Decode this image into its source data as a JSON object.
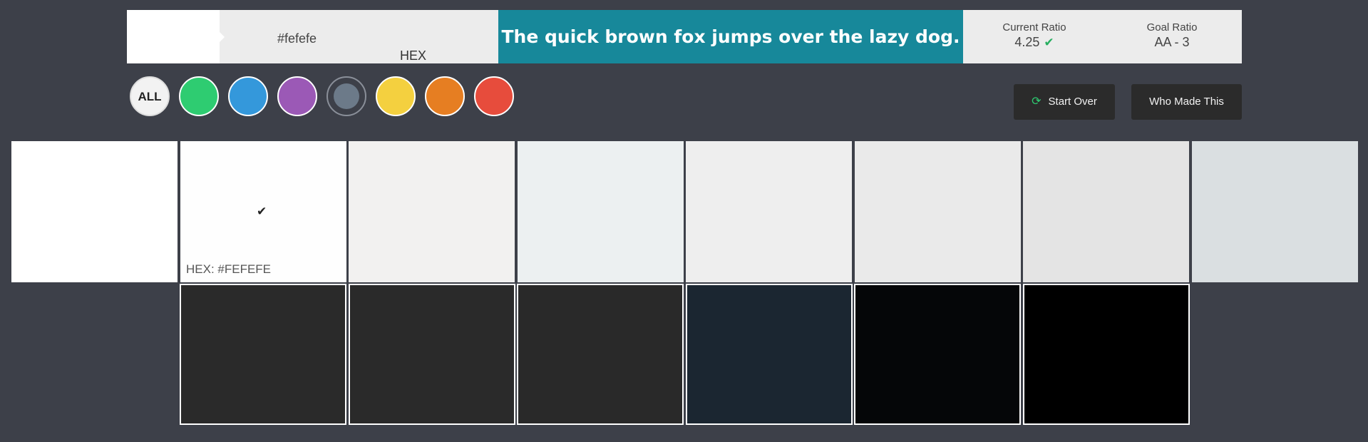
{
  "top_bar": {
    "hex_value": "#fefefe",
    "hex_label": "HEX",
    "sample_text": "The quick brown fox jumps over the lazy dog.",
    "sample_bg": "#17889a",
    "current_ratio_label": "Current Ratio",
    "current_ratio_value": "4.25",
    "current_ratio_icon": "check-icon",
    "goal_ratio_label": "Goal Ratio",
    "goal_ratio_value": "AA - 3"
  },
  "filters": {
    "all_label": "ALL",
    "colors": [
      "#2ecc71",
      "#3498db",
      "#9b59b6",
      "#6c7a89",
      "#f4d03f",
      "#e67e22",
      "#e74c3c"
    ],
    "selected": "#6c7a89"
  },
  "buttons": {
    "start_over": "Start Over",
    "start_over_icon": "refresh-icon",
    "who_made_this": "Who Made This"
  },
  "palette": {
    "light_row": [
      "#ffffff",
      "#fefefe",
      "#f2f1f0",
      "#ecf0f1",
      "#eeeeee",
      "#eaeaea",
      "#e4e4e4",
      "#dadfe1"
    ],
    "dark_row": [
      "#2a2a2a",
      "#2a2a2a",
      "#292929",
      "#1b2631",
      "#050608",
      "#000000"
    ],
    "selected_hex_caption": "HEX: #FEFEFE",
    "selected_icon": "check-icon"
  }
}
